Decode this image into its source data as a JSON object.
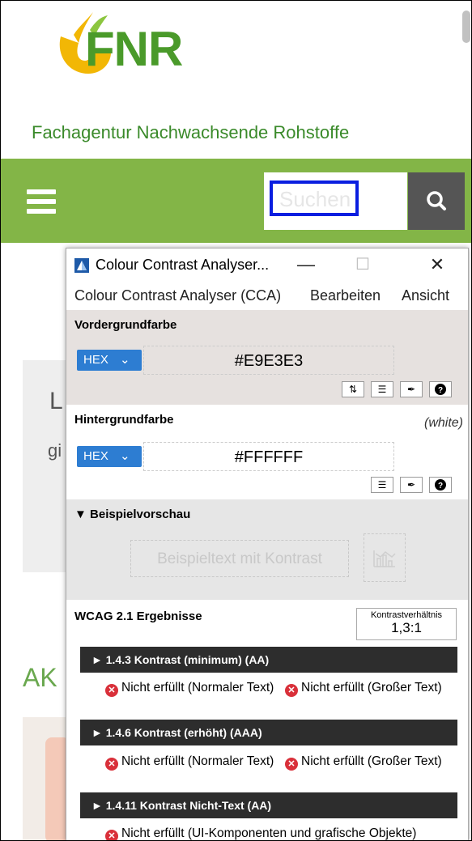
{
  "website": {
    "logo_text": "FNR",
    "tagline": "Fachagentur Nachwachsende Rohstoffe",
    "search_placeholder": "Suchen",
    "bg_letter_L": "L",
    "bg_letters_gi": "gi",
    "bg_heading": "AK"
  },
  "cca": {
    "title": "Colour Contrast Analyser...",
    "window_buttons": {
      "minimize": "—",
      "maximize": "☐",
      "close": "✕"
    },
    "menu": [
      "Colour Contrast Analyser (CCA)",
      "Bearbeiten",
      "Ansicht"
    ],
    "foreground": {
      "label": "Vordergrundfarbe",
      "format": "HEX",
      "value": "#E9E3E3"
    },
    "background": {
      "label": "Hintergrundfarbe",
      "name": "(white)",
      "format": "HEX",
      "value": "#FFFFFF"
    },
    "preview": {
      "label": "▼ Beispielvorschau",
      "sample_text": "Beispieltext mit Kontrast"
    },
    "results": {
      "label": "WCAG 2.1 Ergebnisse",
      "ratio_label": "Kontrastverhältnis",
      "ratio_value": "1,3:1",
      "criteria": [
        {
          "title": "► 1.4.3 Kontrast (minimum) (AA)",
          "fails": [
            "Nicht erfüllt (Normaler Text)",
            "Nicht erfüllt (Großer Text)"
          ]
        },
        {
          "title": "► 1.4.6 Kontrast (erhöht) (AAA)",
          "fails": [
            "Nicht erfüllt (Normaler Text)",
            "Nicht erfüllt (Großer Text)"
          ]
        },
        {
          "title": "► 1.4.11 Kontrast Nicht-Text (AA)",
          "fails": [
            "Nicht erfüllt (UI-Komponenten und grafische Objekte)"
          ]
        }
      ]
    }
  },
  "colors": {
    "brand_green": "#83b547",
    "hex_select_blue": "#2d7dd2",
    "fail_red": "#d9303a",
    "criterion_bar": "#2d2d2d"
  }
}
